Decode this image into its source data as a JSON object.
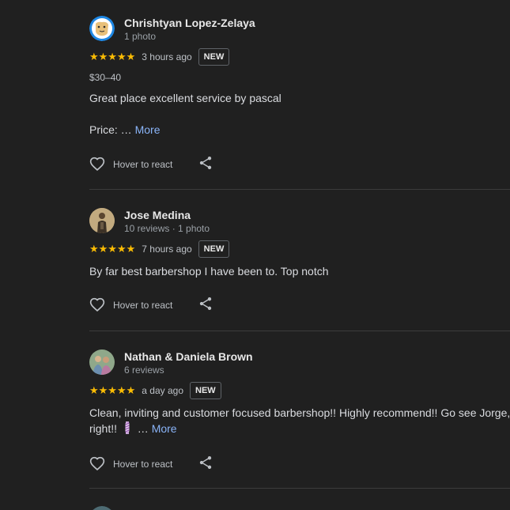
{
  "reviews": [
    {
      "author": "Chrishtyan Lopez-Zelaya",
      "meta": "1 photo",
      "stars": "★★★★★",
      "time": "3 hours ago",
      "badge": "NEW",
      "price_range": "$30–40",
      "text": "Great place excellent service by pascal",
      "price_label": "Price: …",
      "more": "More",
      "react_label": "Hover to react"
    },
    {
      "author": "Jose Medina",
      "meta": "10 reviews · 1 photo",
      "stars": "★★★★★",
      "time": "7 hours ago",
      "badge": "NEW",
      "text": "By far best barbershop I have been to. Top notch",
      "react_label": "Hover to react"
    },
    {
      "author": "Nathan & Daniela Brown",
      "meta": "6 reviews",
      "stars": "★★★★★",
      "time": "a day ago",
      "badge": "NEW",
      "text": "Clean, inviting and customer focused barbershop!! Highly recommend!! Go see Jorge,",
      "text_line2": "right!!",
      "ellipsis": "…",
      "more": "More",
      "react_label": "Hover to react"
    }
  ],
  "icons": {
    "heart": "heart-outline-icon",
    "share": "share-icon",
    "star": "star-icon"
  },
  "colors": {
    "background": "#202020",
    "star": "#fbbc04",
    "link": "#8ab4f8",
    "divider": "#3c3c3c"
  }
}
